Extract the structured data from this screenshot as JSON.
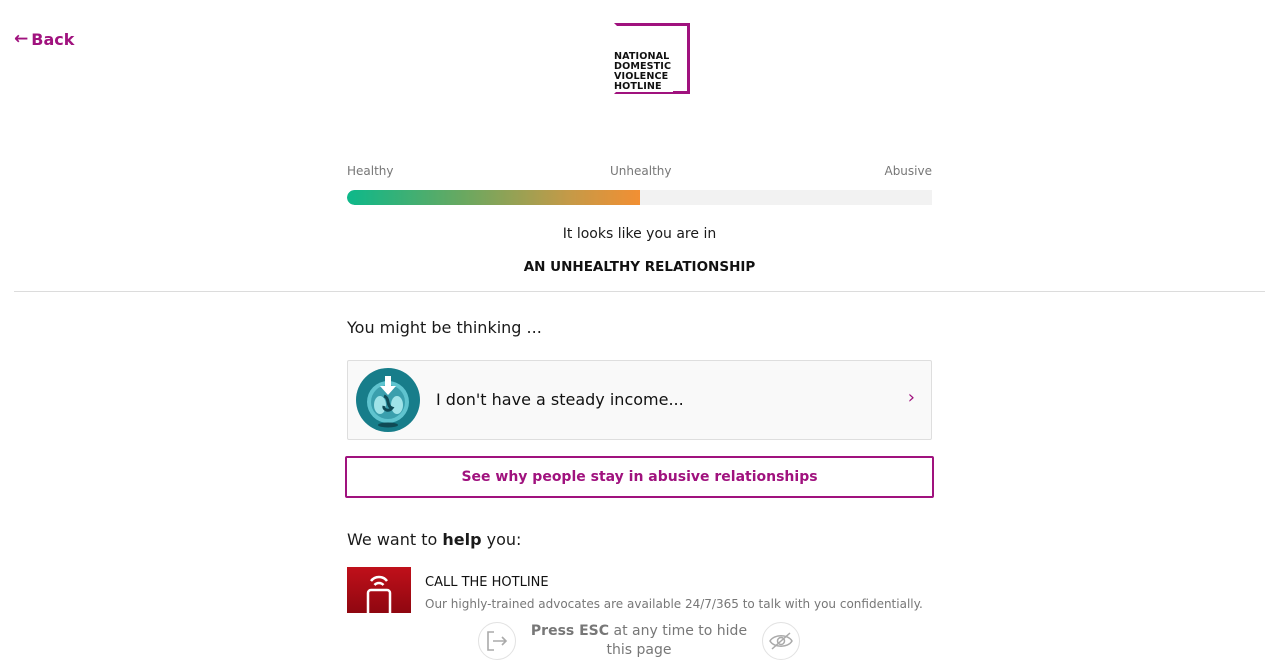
{
  "nav": {
    "back_label": "Back",
    "back_arrow": "←"
  },
  "logo": {
    "lines": [
      "NATIONAL",
      "DOMESTIC",
      "VIOLENCE",
      "HOTLINE"
    ],
    "accent_color": "#a0127e"
  },
  "result": {
    "scale_labels": {
      "healthy": "Healthy",
      "unhealthy": "Unhealthy",
      "abusive": "Abusive"
    },
    "meter_level_percent": 50,
    "intro": "It looks like you are in",
    "title": "AN UNHEALTHY RELATIONSHIP"
  },
  "thinking": {
    "heading": "You might be thinking ...",
    "card": {
      "icon": "falling-coins-icon",
      "label": "I don't have a steady income...",
      "chevron": "›"
    }
  },
  "why_button": {
    "label": "See why people stay in abusive relationships"
  },
  "help": {
    "heading_prefix": "We want to ",
    "heading_bold": "help",
    "heading_suffix": " you:",
    "hotline": {
      "icon": "phone-icon",
      "title": "CALL THE HOTLINE",
      "description": "Our highly-trained advocates are available 24/7/365 to talk with you confidentially."
    }
  },
  "esc": {
    "bold": "Press ESC",
    "rest": " at any time to hide this page",
    "exit_icon": "exit-icon",
    "hide_icon": "eye-off-icon"
  },
  "colors": {
    "accent": "#a0127e",
    "meter_start": "#0db88a",
    "meter_end": "#f28f33",
    "hotline_red": "#b00b15"
  }
}
